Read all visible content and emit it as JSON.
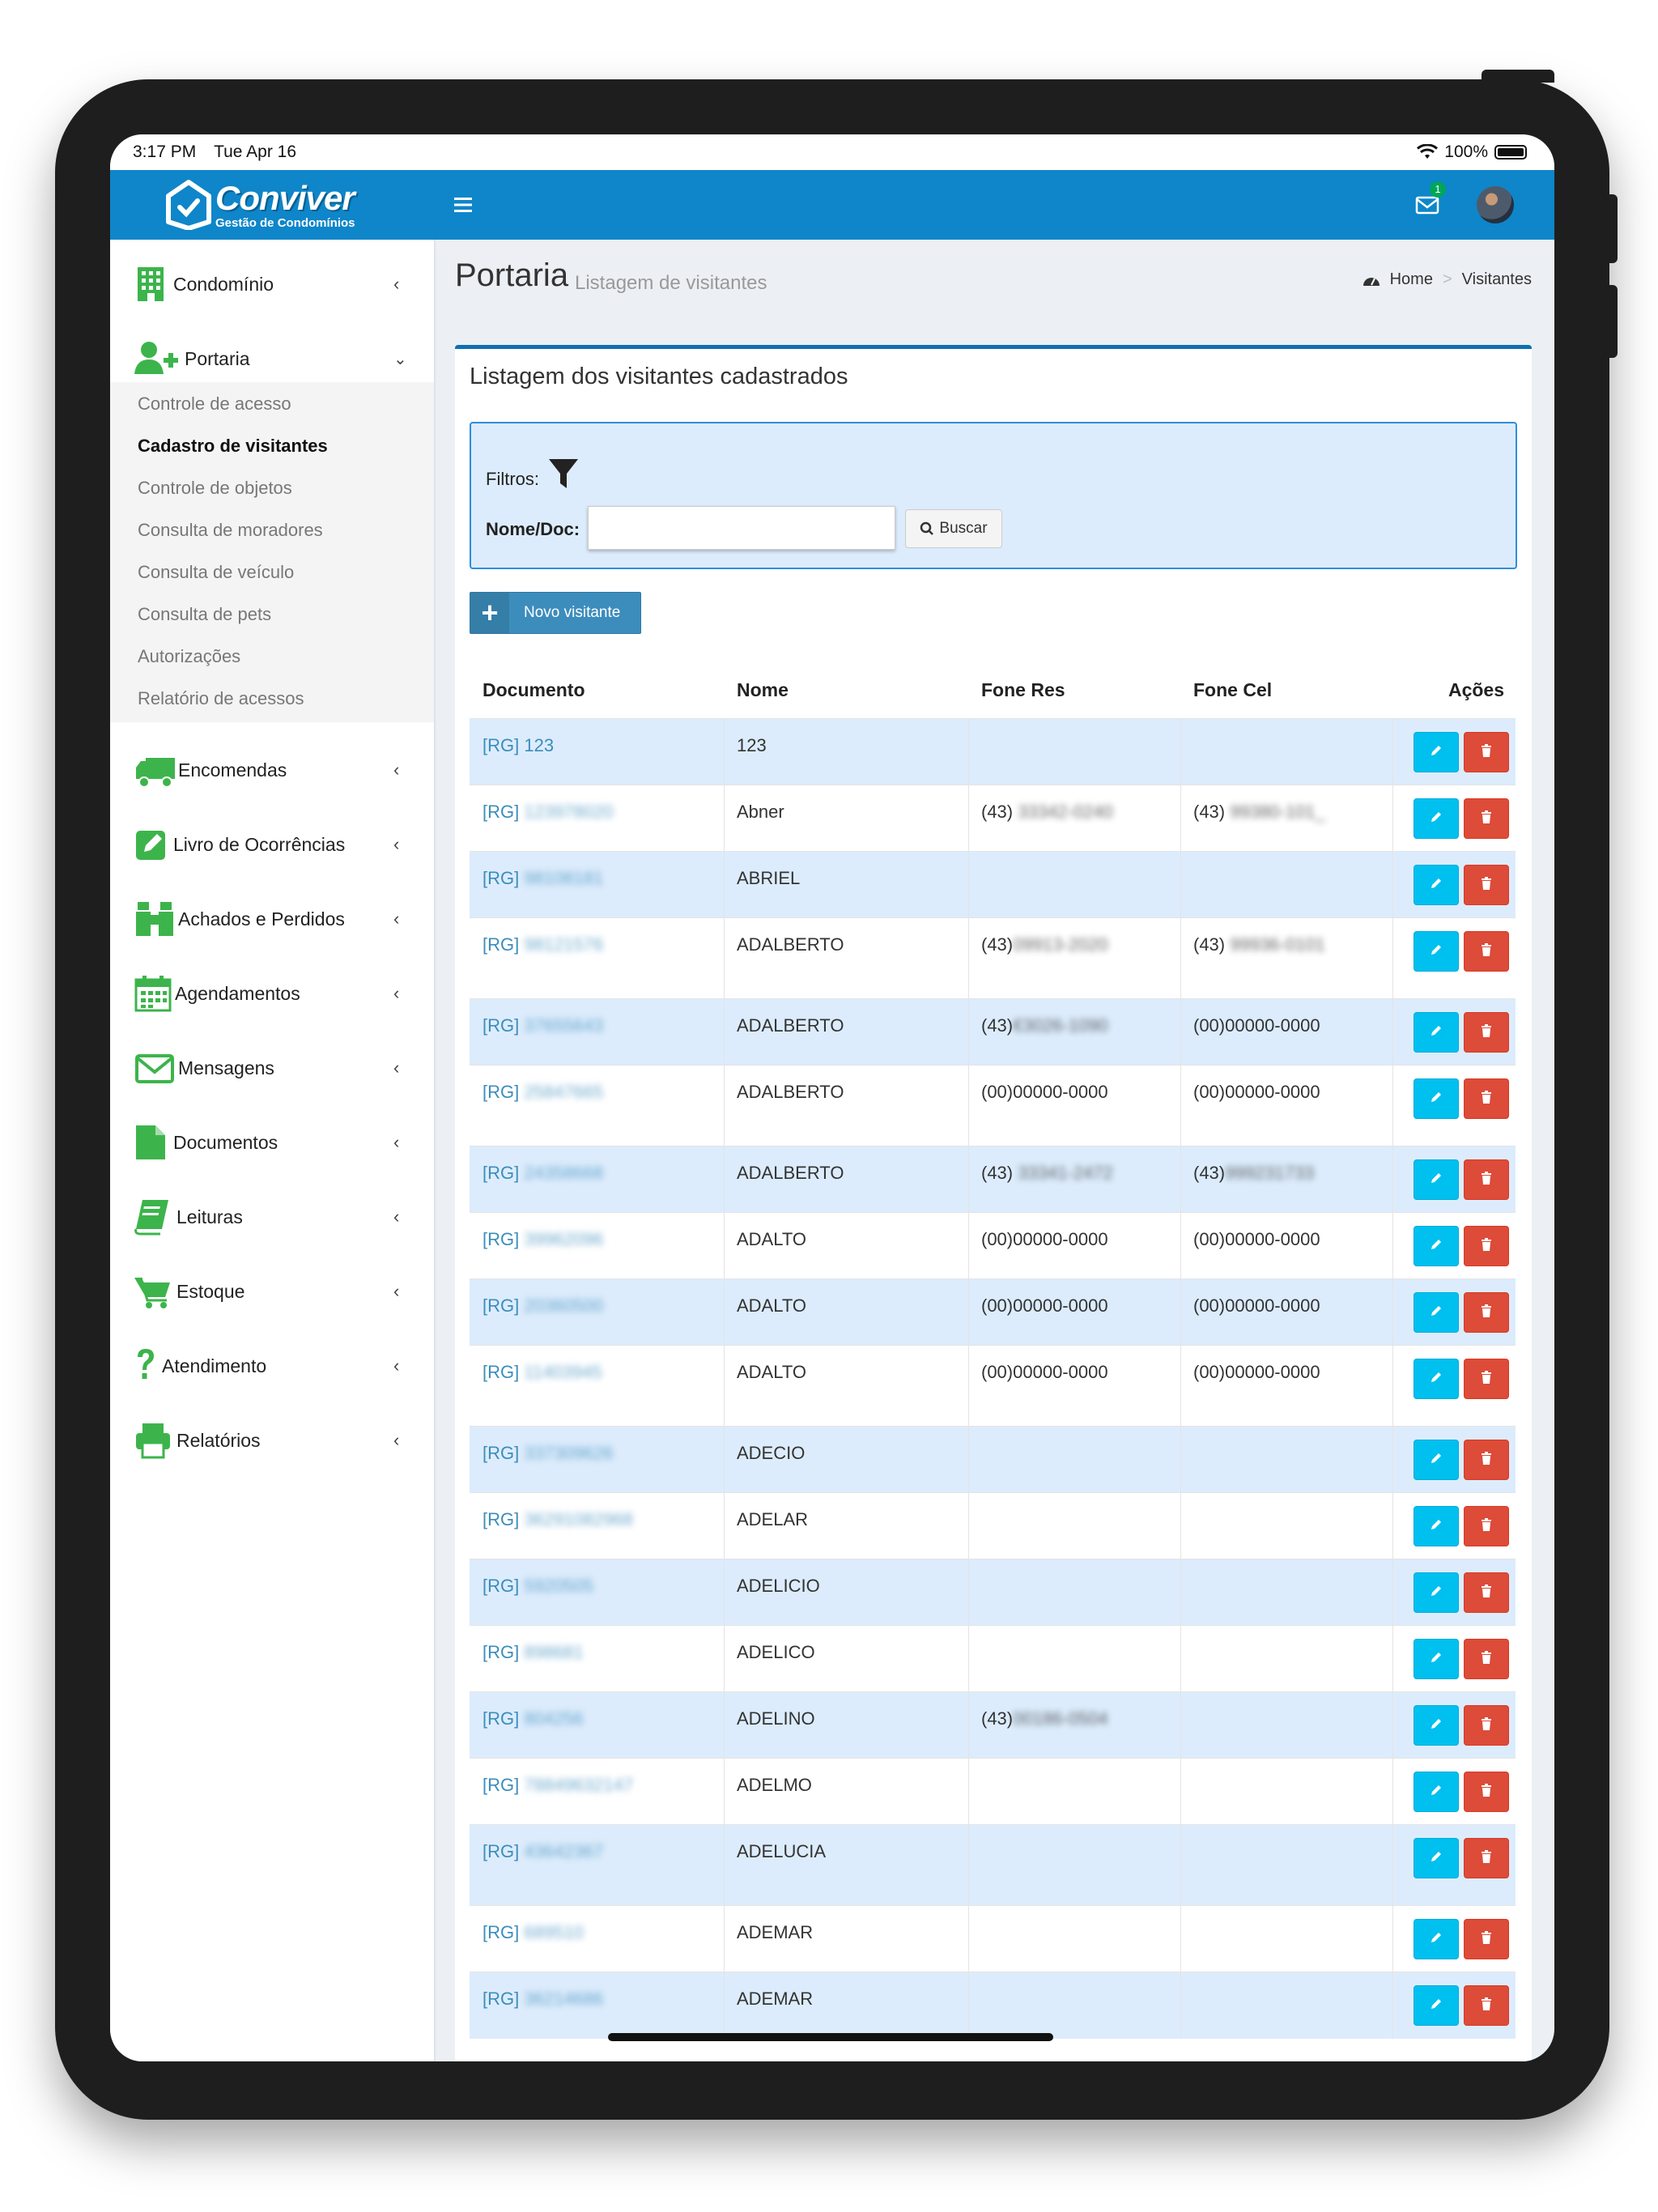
{
  "status_bar": {
    "time": "3:17 PM",
    "date": "Tue Apr 16",
    "battery": "100%"
  },
  "app": {
    "name": "Conviver",
    "tagline": "Gestão de Condomínios",
    "brand_color": "#0e86c9",
    "mail_count": "1"
  },
  "sidebar": {
    "items": [
      {
        "label": "Condomínio",
        "icon": "building-icon"
      },
      {
        "label": "Portaria",
        "icon": "user-plus-icon"
      },
      {
        "label": "Encomendas",
        "icon": "truck-icon"
      },
      {
        "label": "Livro de Ocorrências",
        "icon": "edit-icon"
      },
      {
        "label": "Achados e Perdidos",
        "icon": "binoculars-icon"
      },
      {
        "label": "Agendamentos",
        "icon": "calendar-icon"
      },
      {
        "label": "Mensagens",
        "icon": "envelope-icon"
      },
      {
        "label": "Documentos",
        "icon": "file-icon"
      },
      {
        "label": "Leituras",
        "icon": "book-icon"
      },
      {
        "label": "Estoque",
        "icon": "cart-icon"
      },
      {
        "label": "Atendimento",
        "icon": "question-icon"
      },
      {
        "label": "Relatórios",
        "icon": "printer-icon"
      }
    ],
    "portaria_sub": [
      "Controle de acesso",
      "Cadastro de visitantes",
      "Controle de objetos",
      "Consulta de moradores",
      "Consulta de veículo",
      "Consulta de pets",
      "Autorizações",
      "Relatório de acessos"
    ]
  },
  "page": {
    "title": "Portaria",
    "subtitle": "Listagem de visitantes",
    "breadcrumb_home": "Home",
    "breadcrumb_current": "Visitantes"
  },
  "box": {
    "title": "Listagem dos visitantes cadastrados",
    "filters_label": "Filtros:",
    "name_doc_label": "Nome/Doc:",
    "name_doc_value": "",
    "search_button": "Buscar",
    "new_button": "Novo visitante"
  },
  "table": {
    "headers": [
      "Documento",
      "Nome",
      "Fone Res",
      "Fone Cel",
      "Ações"
    ],
    "rows": [
      {
        "doc_type": "[RG]",
        "doc": "123",
        "name": "123",
        "fone_res_prefix": "",
        "fone_res": "",
        "fone_cel_prefix": "",
        "fone_cel": ""
      },
      {
        "doc_type": "[RG]",
        "doc": "123978020",
        "name": "Abner",
        "fone_res_prefix": "(43)",
        "fone_res": " 33342-0240",
        "fone_cel_prefix": "(43)",
        "fone_cel": " 99380-101_"
      },
      {
        "doc_type": "[RG]",
        "doc": "98108181",
        "name": "ABRIEL",
        "fone_res_prefix": "",
        "fone_res": "",
        "fone_cel_prefix": "",
        "fone_cel": ""
      },
      {
        "doc_type": "[RG]",
        "doc": "98121576",
        "name": "ADALBERTO",
        "fone_res_prefix": "(43)",
        "fone_res": "09913-2020",
        "fone_cel_prefix": "(43)",
        "fone_cel": " 99936-0101"
      },
      {
        "doc_type": "[RG]",
        "doc": "37655643",
        "name": "ADALBERTO",
        "fone_res_prefix": "(43)",
        "fone_res": "€3026-1090",
        "fone_cel_prefix": "",
        "fone_cel": "(00)00000-0000"
      },
      {
        "doc_type": "[RG]",
        "doc": "25847665",
        "name": "ADALBERTO",
        "fone_res_prefix": "",
        "fone_res": "(00)00000-0000",
        "fone_cel_prefix": "",
        "fone_cel": "(00)00000-0000"
      },
      {
        "doc_type": "[RG]",
        "doc": "24358668",
        "name": "ADALBERTO",
        "fone_res_prefix": "(43)",
        "fone_res": " 33341-2472",
        "fone_cel_prefix": "(43)",
        "fone_cel": "999231733"
      },
      {
        "doc_type": "[RG]",
        "doc": "39962096",
        "name": "ADALTO",
        "fone_res_prefix": "",
        "fone_res": "(00)00000-0000",
        "fone_cel_prefix": "",
        "fone_cel": "(00)00000-0000"
      },
      {
        "doc_type": "[RG]",
        "doc": "20360500",
        "name": "ADALTO",
        "fone_res_prefix": "",
        "fone_res": "(00)00000-0000",
        "fone_cel_prefix": "",
        "fone_cel": "(00)00000-0000"
      },
      {
        "doc_type": "[RG]",
        "doc": "11403945",
        "name": "ADALTO",
        "fone_res_prefix": "",
        "fone_res": "(00)00000-0000",
        "fone_cel_prefix": "",
        "fone_cel": "(00)00000-0000"
      },
      {
        "doc_type": "[RG]",
        "doc": "337309626",
        "name": "ADECIO",
        "fone_res_prefix": "",
        "fone_res": "",
        "fone_cel_prefix": "",
        "fone_cel": ""
      },
      {
        "doc_type": "[RG]",
        "doc": "36291082968",
        "name": "ADELAR",
        "fone_res_prefix": "",
        "fone_res": "",
        "fone_cel_prefix": "",
        "fone_cel": ""
      },
      {
        "doc_type": "[RG]",
        "doc": "5920505",
        "name": "ADELICIO",
        "fone_res_prefix": "",
        "fone_res": "",
        "fone_cel_prefix": "",
        "fone_cel": ""
      },
      {
        "doc_type": "[RG]",
        "doc": "898681",
        "name": "ADELICO",
        "fone_res_prefix": "",
        "fone_res": "",
        "fone_cel_prefix": "",
        "fone_cel": ""
      },
      {
        "doc_type": "[RG]",
        "doc": "804256",
        "name": "ADELINO",
        "fone_res_prefix": "(43)",
        "fone_res": "00186-0504",
        "fone_cel_prefix": "",
        "fone_cel": ""
      },
      {
        "doc_type": "[RG]",
        "doc": "78849632147",
        "name": "ADELMO",
        "fone_res_prefix": "",
        "fone_res": "",
        "fone_cel_prefix": "",
        "fone_cel": ""
      },
      {
        "doc_type": "[RG]",
        "doc": "43642367",
        "name": "ADELUCIA",
        "fone_res_prefix": "",
        "fone_res": "",
        "fone_cel_prefix": "",
        "fone_cel": ""
      },
      {
        "doc_type": "[RG]",
        "doc": "689510",
        "name": "ADEMAR",
        "fone_res_prefix": "",
        "fone_res": "",
        "fone_cel_prefix": "",
        "fone_cel": ""
      },
      {
        "doc_type": "[RG]",
        "doc": "36214686",
        "name": "ADEMAR",
        "fone_res_prefix": "",
        "fone_res": "",
        "fone_cel_prefix": "",
        "fone_cel": ""
      }
    ]
  },
  "colors": {
    "edit_button": "#00c0ef",
    "delete_button": "#dd4b39",
    "odd_row": "#dcecfc",
    "accent": "#3c8dbc",
    "sidebar_icon": "#3cb44b"
  }
}
